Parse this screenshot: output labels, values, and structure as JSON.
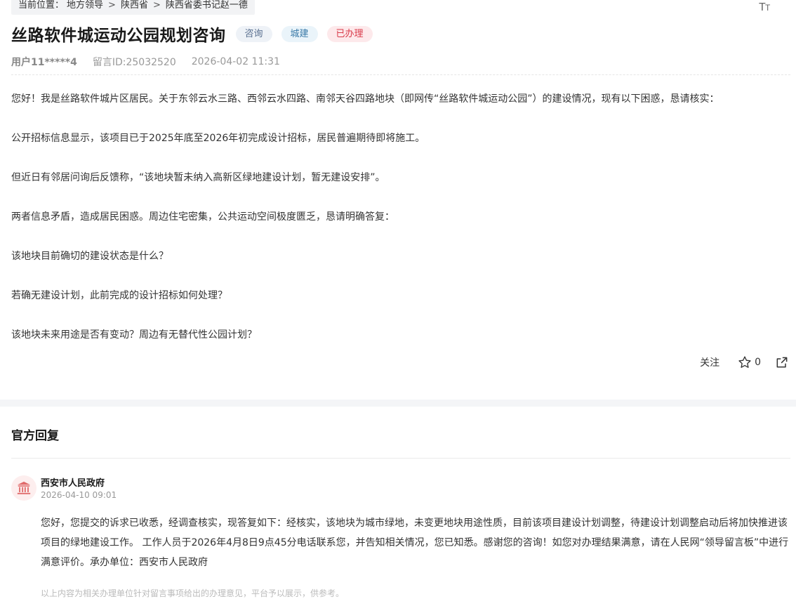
{
  "breadcrumb": {
    "prefix": "当前位置：",
    "items": [
      "地方领导",
      "陕西省",
      "陕西省委书记赵一德"
    ],
    "separator": ">"
  },
  "font_size_button": "TT",
  "message": {
    "title": "丝路软件城运动公园规划咨询",
    "tags": [
      "咨询",
      "城建",
      "已办理"
    ],
    "user": "用户11*****4",
    "message_id": "留言ID:25032520",
    "datetime": "2026-04-02 11:31",
    "paragraphs": [
      "您好！我是丝路软件城片区居民。关于东邻云水三路、西邻云水四路、南邻天谷四路地块（即网传“丝路软件城运动公园”）的建设情况，现有以下困惑，恳请核实：",
      "公开招标信息显示，该项目已于2025年底至2026年初完成设计招标，居民普遍期待即将施工。",
      "但近日有邻居问询后反馈称，“该地块暂未纳入高新区绿地建设计划，暂无建设安排”。",
      "两者信息矛盾，造成居民困惑。周边住宅密集，公共运动空间极度匮乏，恳请明确答复：",
      "该地块目前确切的建设状态是什么？",
      "若确无建设计划，此前完成的设计招标如何处理？",
      "该地块未来用途是否有变动？周边有无替代性公园计划？"
    ]
  },
  "actions": {
    "follow_label": "关注",
    "star_count": "0"
  },
  "reply": {
    "section_title": "官方回复",
    "org_name": "西安市人民政府",
    "time": "2026-04-10 09:01",
    "body": "您好，您提交的诉求已收悉，经调查核实，现答复如下：经核实，该地块为城市绿地，未变更地块用途性质，目前该项目建设计划调整，待建设计划调整启动后将加快推进该项目的绿地建设工作。 工作人员于2026年4月8日9点45分电话联系您，并告知相关情况，您已知悉。感谢您的咨询！如您对办理结果满意，请在人民网“领导留言板”中进行满意评价。承办单位：西安市人民政府",
    "disclaimer": "以上内容为相关办理单位针对留言事项给出的办理意见，平台予以展示，供参考。"
  },
  "icons": {
    "star": "star-outline-icon",
    "share": "share-icon",
    "avatar": "government-building-icon"
  },
  "colors": {
    "tag_consult": "#5a7090",
    "tag_urban": "#3a7aa8",
    "tag_done": "#d93a4a",
    "avatar_icon": "#e06a6a"
  }
}
